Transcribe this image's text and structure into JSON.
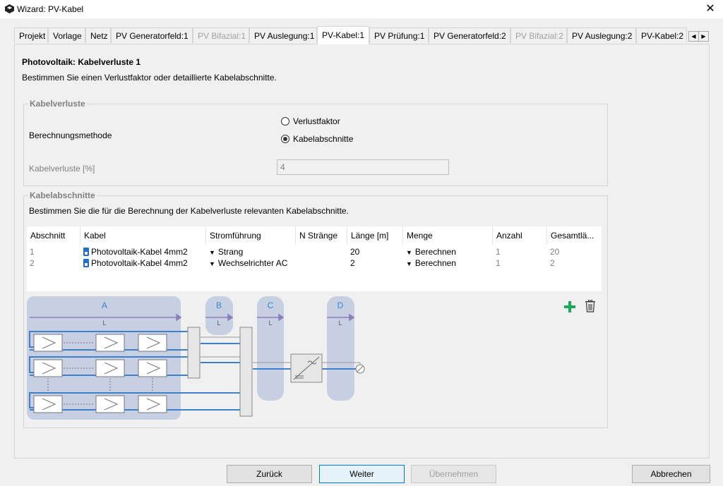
{
  "window": {
    "title": "Wizard: PV-Kabel"
  },
  "tabs": [
    {
      "label": "Projekt"
    },
    {
      "label": "Vorlage"
    },
    {
      "label": "Netz"
    },
    {
      "label": "PV Generatorfeld:1"
    },
    {
      "label": "PV Bifazial:1"
    },
    {
      "label": "PV Auslegung:1"
    },
    {
      "label": "PV-Kabel:1"
    },
    {
      "label": "PV Prüfung:1"
    },
    {
      "label": "PV Generatorfeld:2"
    },
    {
      "label": "PV Bifazial:2"
    },
    {
      "label": "PV Auslegung:2"
    },
    {
      "label": "PV-Kabel:2"
    }
  ],
  "page": {
    "title": "Photovoltaik: Kabelverluste 1",
    "description": "Bestimmen Sie einen Verlustfaktor oder detaillierte Kabelabschnitte."
  },
  "kabelverluste": {
    "group_title": "Kabelverluste",
    "method_label": "Berechnungsmethode",
    "option_verlustfaktor": "Verlustfaktor",
    "option_kabelabschnitte": "Kabelabschnitte",
    "selected": "Kabelabschnitte",
    "loss_label": "Kabelverluste [%]",
    "loss_value": "4"
  },
  "kabelabschnitte": {
    "group_title": "Kabelabschnitte",
    "description": "Bestimmen Sie die für die Berechnung der Kabelverluste relevanten Kabelabschnitte.",
    "columns": [
      "Abschnitt",
      "Kabel",
      "Stromführung",
      "N Stränge",
      "Länge [m]",
      "Menge",
      "Anzahl",
      "Gesamtlä..."
    ],
    "rows": [
      {
        "abschnitt": "1",
        "kabel": "Photovoltaik-Kabel 4mm2",
        "stromfuehrung": "Strang",
        "n_straenge": "",
        "laenge": "20",
        "menge": "Berechnen",
        "anzahl": "1",
        "gesamt": "20"
      },
      {
        "abschnitt": "2",
        "kabel": "Photovoltaik-Kabel 4mm2",
        "stromfuehrung": "Wechselrichter AC",
        "n_straenge": "",
        "laenge": "2",
        "menge": "Berechnen",
        "anzahl": "1",
        "gesamt": "2"
      }
    ]
  },
  "diagram": {
    "labels": [
      "A",
      "B",
      "C",
      "D"
    ],
    "length_symbol": "L"
  },
  "buttons": {
    "back": "Zurück",
    "next": "Weiter",
    "apply": "Übernehmen",
    "cancel": "Abbrechen"
  },
  "colors": {
    "accent": "#0078d7",
    "diagram_zone": "#c7cfe3",
    "diagram_line": "#3f7fc9",
    "add": "#1aa85a"
  }
}
